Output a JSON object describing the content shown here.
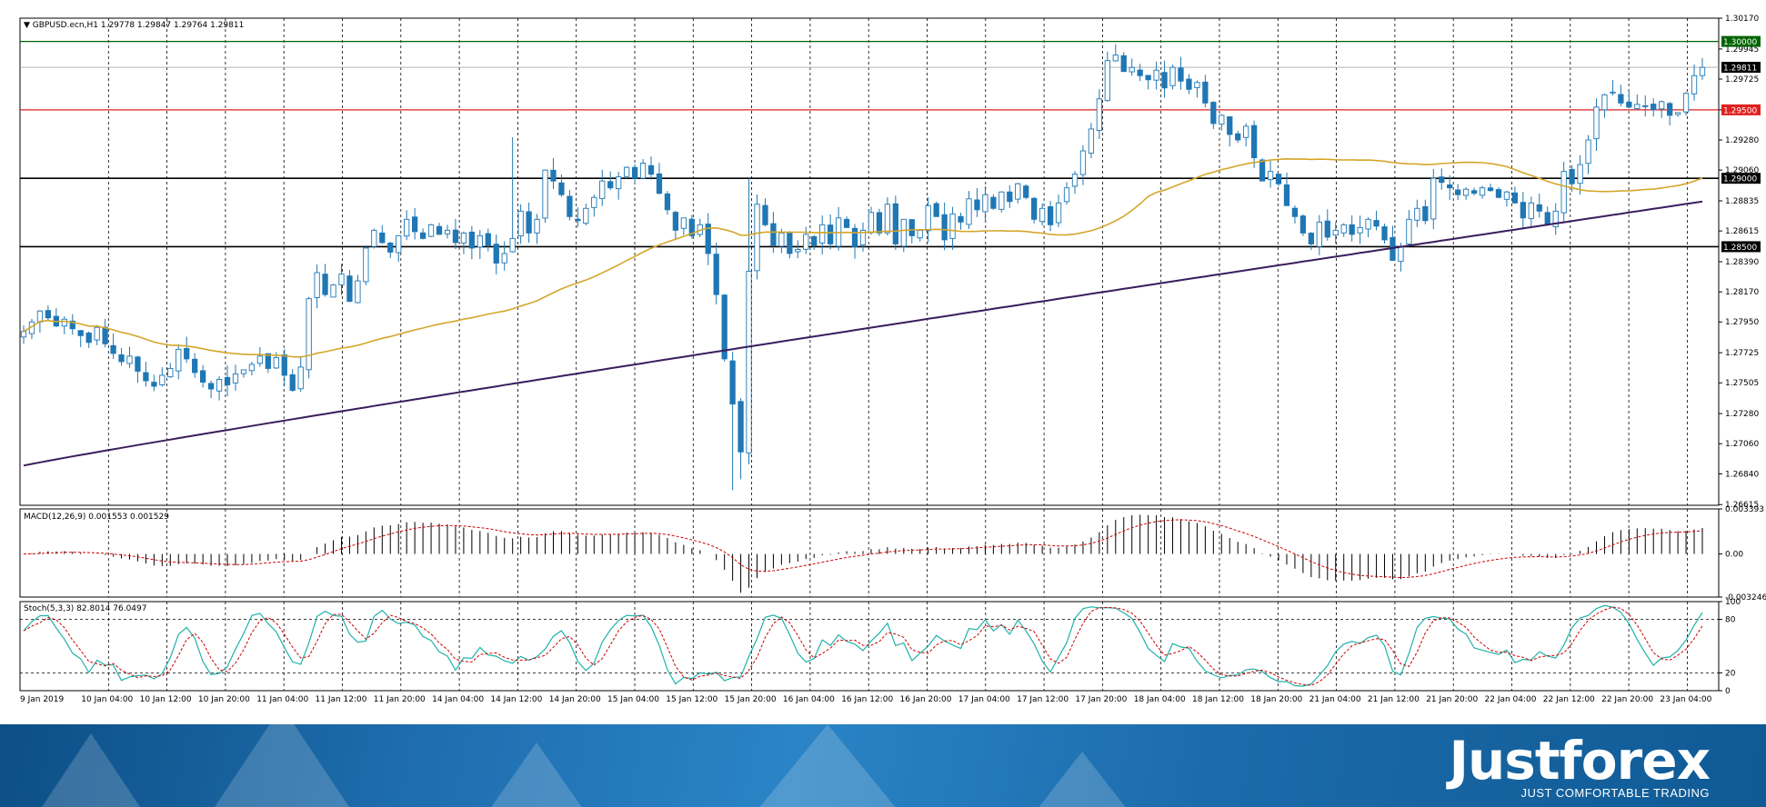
{
  "header": {
    "symbol_label": "GBPUSD.ecn,H1  1.29778 1.29847 1.29764 1.29811"
  },
  "macd": {
    "label": "MACD(12,26,9) 0.001553 0.001529",
    "ticks": [
      "0.003393",
      "0.00",
      "-0.003246"
    ]
  },
  "stoch": {
    "label": "Stoch(5,3,3) 82.8014 76.0497",
    "ticks": [
      "100",
      "80",
      "20",
      "0"
    ]
  },
  "price_ticks": [
    "1.30170",
    "1.29945",
    "1.29725",
    "1.29500",
    "1.29280",
    "1.29060",
    "1.28835",
    "1.28615",
    "1.28390",
    "1.28170",
    "1.27950",
    "1.27725",
    "1.27505",
    "1.27280",
    "1.27060",
    "1.26840",
    "1.26615"
  ],
  "level_labels": [
    "1.30000",
    "1.29500",
    "1.29000",
    "1.28500",
    "1.29811"
  ],
  "time_ticks": [
    "9 Jan 2019",
    "10 Jan 04:00",
    "10 Jan 12:00",
    "10 Jan 20:00",
    "11 Jan 04:00",
    "11 Jan 12:00",
    "11 Jan 20:00",
    "14 Jan 04:00",
    "14 Jan 12:00",
    "14 Jan 20:00",
    "15 Jan 04:00",
    "15 Jan 12:00",
    "15 Jan 20:00",
    "16 Jan 04:00",
    "16 Jan 12:00",
    "16 Jan 20:00",
    "17 Jan 04:00",
    "17 Jan 12:00",
    "17 Jan 20:00",
    "18 Jan 04:00",
    "18 Jan 12:00",
    "18 Jan 20:00",
    "21 Jan 04:00",
    "21 Jan 12:00",
    "21 Jan 20:00",
    "22 Jan 04:00",
    "22 Jan 12:00",
    "22 Jan 20:00",
    "23 Jan 04:00"
  ],
  "brand": {
    "name": "Justforex",
    "tagline": "JUST COMFORTABLE TRADING"
  },
  "colors": {
    "candle_up": "#1f77b4",
    "candle_down": "#1f77b4",
    "ma_slow": "#3b1d5e",
    "ma_fast": "#d4a62a",
    "level_1_30000": "#006400",
    "level_1_29500": "#e02020",
    "level_support": "#000000",
    "macd_hist": "#000000",
    "macd_signal": "#cc0000",
    "stoch_main": "#20b2aa",
    "stoch_signal": "#cc0000"
  },
  "chart_data": [
    {
      "type": "candlestick",
      "title": "GBPUSD.ecn,H1",
      "ylim": [
        1.2661,
        1.3017
      ],
      "horizontal_levels": [
        1.3,
        1.295,
        1.29,
        1.285
      ],
      "last_price": 1.29811,
      "closes": [
        1.2788,
        1.2795,
        1.2803,
        1.2798,
        1.2792,
        1.2797,
        1.279,
        1.2785,
        1.278,
        1.2791,
        1.2779,
        1.2772,
        1.2766,
        1.277,
        1.2759,
        1.2752,
        1.2748,
        1.2756,
        1.2761,
        1.2775,
        1.2768,
        1.2758,
        1.2751,
        1.2746,
        1.2753,
        1.2749,
        1.2757,
        1.276,
        1.2764,
        1.277,
        1.2761,
        1.2769,
        1.2756,
        1.2745,
        1.2762,
        1.2812,
        1.2831,
        1.2815,
        1.2822,
        1.283,
        1.281,
        1.2825,
        1.2849,
        1.2862,
        1.2853,
        1.2846,
        1.2858,
        1.287,
        1.2861,
        1.2856,
        1.2866,
        1.2859,
        1.2862,
        1.2853,
        1.286,
        1.2849,
        1.2858,
        1.2851,
        1.2838,
        1.2845,
        1.2856,
        1.2876,
        1.286,
        1.287,
        1.2906,
        1.2898,
        1.2888,
        1.2872,
        1.2869,
        1.2878,
        1.2886,
        1.2898,
        1.2893,
        1.2901,
        1.2908,
        1.29,
        1.2911,
        1.2903,
        1.2889,
        1.2877,
        1.2862,
        1.2871,
        1.2858,
        1.2866,
        1.2845,
        1.2815,
        1.2768,
        1.2735,
        1.27,
        1.2832,
        1.2881,
        1.2866,
        1.2851,
        1.286,
        1.2845,
        1.2848,
        1.2859,
        1.2851,
        1.2866,
        1.2852,
        1.2871,
        1.2864,
        1.285,
        1.2862,
        1.2875,
        1.286,
        1.2881,
        1.2852,
        1.287,
        1.2858,
        1.2862,
        1.288,
        1.2872,
        1.2855,
        1.2874,
        1.2868,
        1.2885,
        1.2877,
        1.2888,
        1.2878,
        1.289,
        1.2883,
        1.2896,
        1.2886,
        1.287,
        1.2878,
        1.2866,
        1.2882,
        1.2893,
        1.2903,
        1.292,
        1.2936,
        1.2958,
        1.2986,
        1.299,
        1.2978,
        1.2981,
        1.2975,
        1.2972,
        1.2979,
        1.2966,
        1.2981,
        1.2971,
        1.2965,
        1.297,
        1.2955,
        1.294,
        1.2946,
        1.2932,
        1.2928,
        1.2938,
        1.2915,
        1.2898,
        1.2905,
        1.2896,
        1.288,
        1.2872,
        1.286,
        1.2852,
        1.2868,
        1.2857,
        1.2862,
        1.2866,
        1.2859,
        1.2864,
        1.287,
        1.2865,
        1.2855,
        1.284,
        1.285,
        1.287,
        1.2878,
        1.2869,
        1.29,
        1.2897,
        1.2893,
        1.2888,
        1.2892,
        1.2889,
        1.2893,
        1.2891,
        1.2886,
        1.289,
        1.2882,
        1.2871,
        1.2882,
        1.2876,
        1.2866,
        1.2876,
        1.2905,
        1.2896,
        1.291,
        1.2928,
        1.2952,
        1.2961,
        1.2963,
        1.2955,
        1.2952,
        1.2954,
        1.2953,
        1.295,
        1.2956,
        1.2946,
        1.2948,
        1.2962,
        1.2975,
        1.2981
      ]
    },
    {
      "type": "line",
      "title": "MACD(12,26,9)",
      "main": 0.001553,
      "signal": 0.001529,
      "ylim": [
        -0.003246,
        0.003393
      ]
    },
    {
      "type": "line",
      "title": "Stoch(5,3,3)",
      "main": 82.8014,
      "signal": 76.0497,
      "ylim": [
        0,
        100
      ],
      "levels": [
        20,
        80
      ]
    }
  ]
}
